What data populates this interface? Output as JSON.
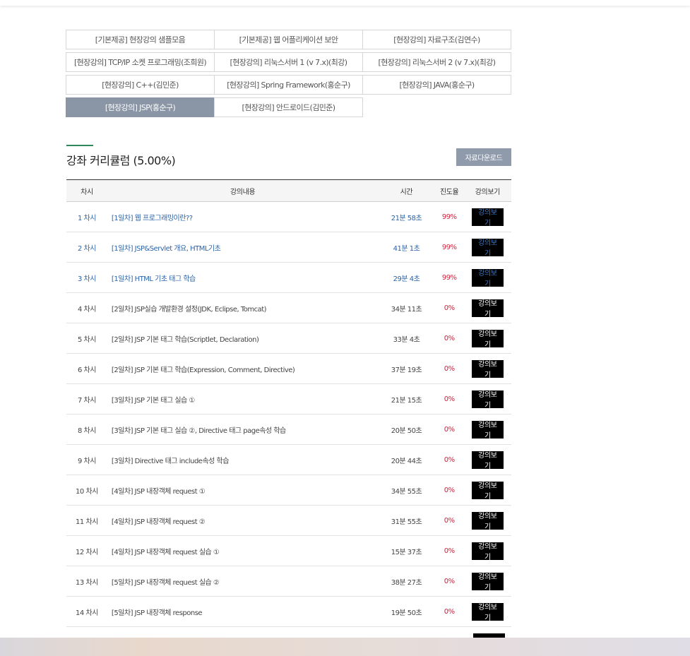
{
  "courses": [
    {
      "label": "[기본제공] 현장강의 샘플모음",
      "active": false
    },
    {
      "label": "[기본제공] 웹 어플리케이션 보안",
      "active": false
    },
    {
      "label": "[현장강의] 자료구조(김연수)",
      "active": false
    },
    {
      "label": "[현장강의] TCP/IP 소켓 프로그래밍(조희원)",
      "active": false
    },
    {
      "label": "[현장강의] 리눅스서버 1 (v 7.x)(최강)",
      "active": false
    },
    {
      "label": "[현장강의] 리눅스서버 2 (v 7.x)(최강)",
      "active": false
    },
    {
      "label": "[현장강의] C++(김민준)",
      "active": false
    },
    {
      "label": "[현장강의] Spring Framework(홍순구)",
      "active": false
    },
    {
      "label": "[현장강의] JAVA(홍순구)",
      "active": false
    },
    {
      "label": "[현장강의] JSP(홍순구)",
      "active": true
    },
    {
      "label": "[현장강의] 안드로이드(김민준)",
      "active": false
    }
  ],
  "section": {
    "title": "강좌 커리큘럼 (5.00%)",
    "download_label": "자료다운로드"
  },
  "table": {
    "headers": {
      "no": "차시",
      "title": "강의내용",
      "time": "시간",
      "progress": "진도율",
      "view": "강의보기"
    },
    "rows": [
      {
        "no": "1 차시",
        "title": "[1일차] 웹 프로그래밍이란??",
        "time": "21분 58초",
        "progress": "99%",
        "view": "강의보기",
        "watched": true
      },
      {
        "no": "2 차시",
        "title": "[1일차] JSP&Servlet 개요, HTML기초",
        "time": "41분 1초",
        "progress": "99%",
        "view": "강의보기",
        "watched": true
      },
      {
        "no": "3 차시",
        "title": "[1일차] HTML 기초 태그 학습",
        "time": "29분 4초",
        "progress": "99%",
        "view": "강의보기",
        "watched": true
      },
      {
        "no": "4 차시",
        "title": "[2일차] JSP실습 개발환경 설정(JDK, Eclipse, Tomcat)",
        "time": "34분 11초",
        "progress": "0%",
        "view": "강의보기",
        "watched": false
      },
      {
        "no": "5 차시",
        "title": "[2일차] JSP 기본 태그 학습(Scriptlet, Declaration)",
        "time": "33분 4초",
        "progress": "0%",
        "view": "강의보기",
        "watched": false
      },
      {
        "no": "6 차시",
        "title": "[2일차] JSP 기본 태그 학습(Expression, Comment, Directive)",
        "time": "37분 19초",
        "progress": "0%",
        "view": "강의보기",
        "watched": false
      },
      {
        "no": "7 차시",
        "title": "[3일차] JSP 기본 태그 실습 ①",
        "time": "21분 15초",
        "progress": "0%",
        "view": "강의보기",
        "watched": false
      },
      {
        "no": "8 차시",
        "title": "[3일차] JSP 기본 태그 실습 ②, Directive 태그 page속성 학습",
        "time": "20분 50초",
        "progress": "0%",
        "view": "강의보기",
        "watched": false
      },
      {
        "no": "9 차시",
        "title": "[3일차] Directive 태그 include속성 학습",
        "time": "20분 44초",
        "progress": "0%",
        "view": "강의보기",
        "watched": false
      },
      {
        "no": "10 차시",
        "title": "[4일차] JSP 내장객체 request ①",
        "time": "34분 55초",
        "progress": "0%",
        "view": "강의보기",
        "watched": false
      },
      {
        "no": "11 차시",
        "title": "[4일차] JSP 내장객체 request ②",
        "time": "31분 55초",
        "progress": "0%",
        "view": "강의보기",
        "watched": false
      },
      {
        "no": "12 차시",
        "title": "[4일차] JSP 내장객체 request 실습 ①",
        "time": "15분 37초",
        "progress": "0%",
        "view": "강의보기",
        "watched": false
      },
      {
        "no": "13 차시",
        "title": "[5일차] JSP 내장객체 request 실습 ②",
        "time": "38분 27초",
        "progress": "0%",
        "view": "강의보기",
        "watched": false
      },
      {
        "no": "14 차시",
        "title": "[5일차] JSP 내장객체 response",
        "time": "19분 50초",
        "progress": "0%",
        "view": "강의보기",
        "watched": false
      }
    ]
  }
}
